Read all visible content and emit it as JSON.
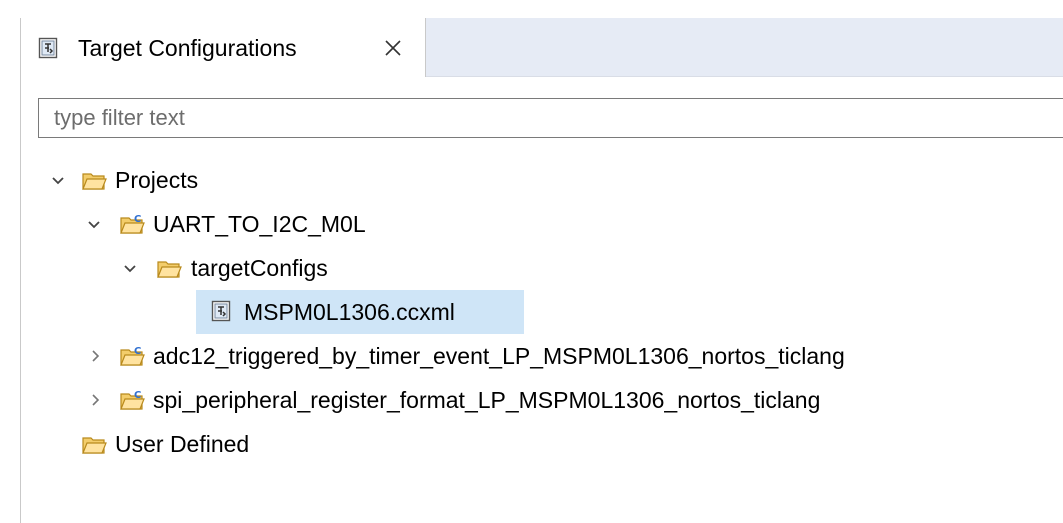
{
  "view": {
    "tab_title": "Target Configurations",
    "tab_icon": "target-config-file-icon",
    "close_icon": "close-icon"
  },
  "filter": {
    "value": "",
    "placeholder": "type filter text"
  },
  "tree": {
    "projects": {
      "label": "Projects",
      "expanded": true,
      "icon": "folder-open-icon"
    },
    "uart_project": {
      "label": "UART_TO_I2C_M0L",
      "expanded": true,
      "icon": "c-project-folder-icon"
    },
    "target_configs": {
      "label": "targetConfigs",
      "expanded": true,
      "icon": "folder-open-icon"
    },
    "ccxml_file": {
      "label": "MSPM0L1306.ccxml",
      "selected": true,
      "icon": "target-config-file-icon"
    },
    "adc_project": {
      "label": "adc12_triggered_by_timer_event_LP_MSPM0L1306_nortos_ticlang",
      "expanded": false,
      "icon": "c-project-folder-icon"
    },
    "spi_project": {
      "label": "spi_peripheral_register_format_LP_MSPM0L1306_nortos_ticlang",
      "expanded": false,
      "icon": "c-project-folder-icon"
    },
    "user_defined": {
      "label": "User Defined",
      "icon": "folder-open-icon"
    }
  },
  "colors": {
    "tab_bar": "#e6ebf5",
    "selection": "#cfe5f7",
    "folder": "#e8b84a",
    "c_badge": "#3a7bd5"
  }
}
